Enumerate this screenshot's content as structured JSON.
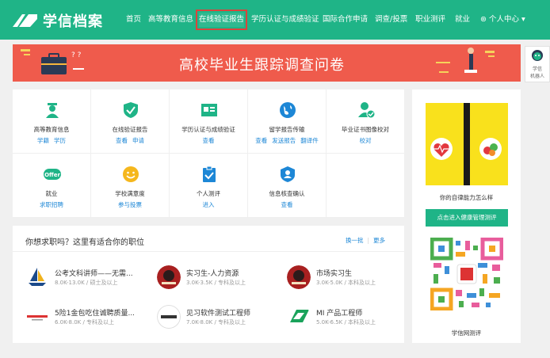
{
  "header": {
    "logo_text": "学信档案",
    "nav": [
      "首页",
      "高等教育信息",
      "在线验证报告",
      "学历认证与成绩验证",
      "国际合作申请",
      "调查/投票",
      "职业测评",
      "就业"
    ],
    "active_nav_index": 2,
    "user_center": "个人中心"
  },
  "banner": {
    "title": "高校毕业生跟踪调查问卷"
  },
  "side_widget": {
    "label_line1": "学信",
    "label_line2": "机器人"
  },
  "services": [
    {
      "title": "高等教育信息",
      "links": [
        "学籍",
        "学历"
      ],
      "icon": "graduate-icon",
      "color": "#1fb487"
    },
    {
      "title": "在线验证报告",
      "links": [
        "查看",
        "申请"
      ],
      "icon": "shield-check-icon",
      "color": "#1fb487"
    },
    {
      "title": "学历认证与成绩验证",
      "links": [
        "查看"
      ],
      "icon": "id-card-icon",
      "color": "#1fb487"
    },
    {
      "title": "留学报告传输",
      "links": [
        "查看",
        "发送报告",
        "翻译件"
      ],
      "icon": "globe-icon",
      "color": "#1d87d6"
    },
    {
      "title": "毕业证书图像校对",
      "links": [
        "校对"
      ],
      "icon": "user-check-icon",
      "color": "#1fb487"
    },
    {
      "title": "就业",
      "links": [
        "求职招聘"
      ],
      "icon": "offer-icon",
      "color": "#1fb487"
    },
    {
      "title": "学校满意度",
      "links": [
        "参与投票"
      ],
      "icon": "smiley-icon",
      "color": "#f5b71d"
    },
    {
      "title": "个人测评",
      "links": [
        "进入"
      ],
      "icon": "clipboard-check-icon",
      "color": "#1d87d6"
    },
    {
      "title": "信息核查确认",
      "links": [
        "查看"
      ],
      "icon": "badge-icon",
      "color": "#1d87d6"
    }
  ],
  "jobs": {
    "title": "你想求职吗？这里有适合你的职位",
    "refresh_label": "换一批",
    "more_label": "更多",
    "items": [
      {
        "title": "公考文科讲师——无需...",
        "meta": "8.0K-13.0K / 硕士及以上",
        "logo": "sailboat-logo-icon"
      },
      {
        "title": "实习生-人力资源",
        "meta": "3.0K-3.5K / 专科及以上",
        "logo": "red-crest-logo-icon"
      },
      {
        "title": "市场实习生",
        "meta": "3.0K-5.0K / 本科及以上",
        "logo": "red-crest-logo-icon"
      },
      {
        "title": "5险1金包吃住诚聘质量...",
        "meta": "6.0K-8.0K / 专科及以上",
        "logo": "company-wordmark-logo-icon"
      },
      {
        "title": "见习软件测试工程师",
        "meta": "7.0K-8.0K / 专科及以上",
        "logo": "company-wordmark-logo-icon"
      },
      {
        "title": "MI 产品工程师",
        "meta": "5.0K-6.5K / 本科及以上",
        "logo": "green-wedge-logo-icon"
      }
    ]
  },
  "ad": {
    "caption": "你的自律能力怎么样",
    "button": "点击进入健康管理测评",
    "qr_caption": "学信网测评"
  }
}
